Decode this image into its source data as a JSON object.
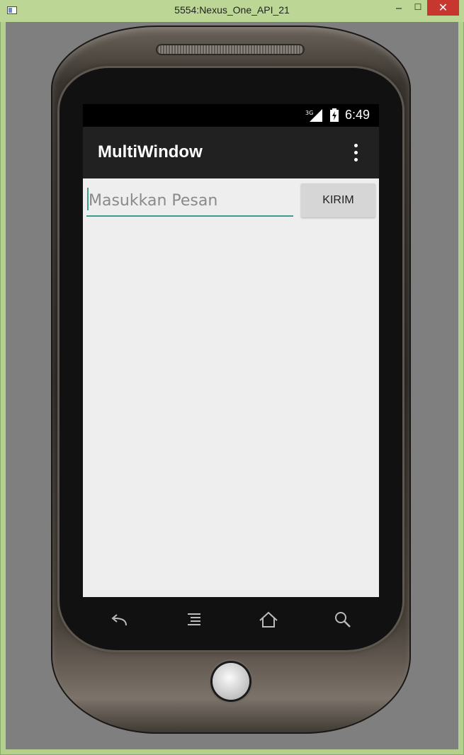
{
  "window": {
    "title": "5554:Nexus_One_API_21",
    "minimize_label": "‒",
    "maximize_label": "☐",
    "close_label": "✕"
  },
  "status_bar": {
    "network": "3G",
    "time": "6:49"
  },
  "app_bar": {
    "title": "MultiWindow"
  },
  "form": {
    "message_placeholder": "Masukkan Pesan",
    "send_label": "KIRIM"
  },
  "nav_keys": [
    "back-icon",
    "menu-icon",
    "home-icon",
    "search-icon"
  ],
  "colors": {
    "accent": "#3e9c8c",
    "app_bar": "#212121",
    "screen_bg": "#eeeeee",
    "button_bg": "#d6d6d6",
    "close_button": "#c7372f"
  }
}
